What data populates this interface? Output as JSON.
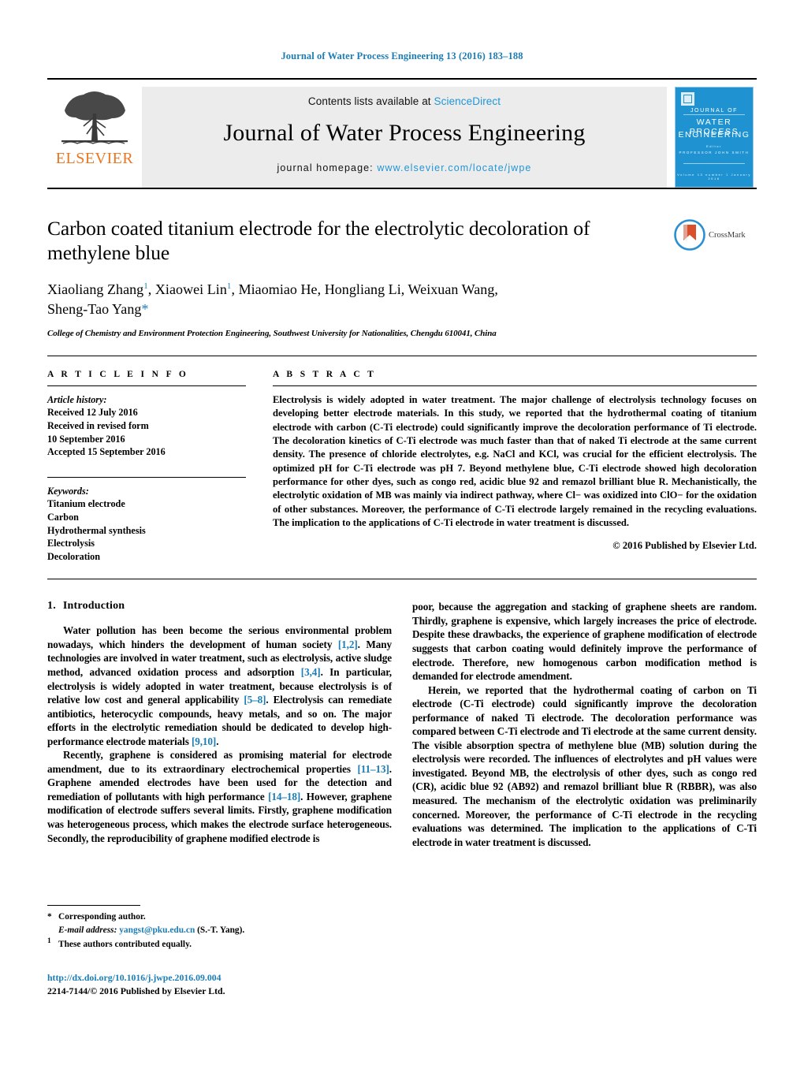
{
  "running_head": "Journal of Water Process Engineering 13 (2016) 183–188",
  "masthead": {
    "contents_prefix": "Contents lists available at ",
    "sciencedirect": "ScienceDirect",
    "journal_title": "Journal of Water Process Engineering",
    "homepage_prefix": "journal homepage: ",
    "homepage_url": "www.elsevier.com/locate/jwpe",
    "publisher_word": "ELSEVIER",
    "publisher_color": "#E87722",
    "link_color": "#2196d6",
    "cover": {
      "line1": "JOURNAL OF",
      "line2": "WATER PROCESS",
      "line3": "ENGINEERING",
      "line4": "Editor",
      "line5": "PROFESSOR JOHN SMITH",
      "line6": "Volume 13 number 1 January 2016",
      "background": "#1f93d2"
    }
  },
  "article": {
    "title": "Carbon coated titanium electrode for the electrolytic decoloration of methylene blue",
    "authors_line1_a": "Xiaoliang Zhang",
    "authors_sup1": "1",
    "authors_line1_b": ", Xiaowei Lin",
    "authors_sup2": "1",
    "authors_line1_c": ", Miaomiao He, Hongliang Li, Weixuan Wang,",
    "authors_line2": "Sheng-Tao Yang",
    "authors_star": "*",
    "affiliation": "College of Chemistry and Environment Protection Engineering, Southwest University for Nationalities, Chengdu 610041, China",
    "crossmark_label": "CrossMark"
  },
  "article_info": {
    "heading": "A R T I C L E   I N F O",
    "history_label": "Article history:",
    "history": [
      "Received 12 July 2016",
      "Received in revised form",
      "10 September 2016",
      "Accepted 15 September 2016"
    ],
    "keywords_label": "Keywords:",
    "keywords": [
      "Titanium electrode",
      "Carbon",
      "Hydrothermal synthesis",
      "Electrolysis",
      "Decoloration"
    ]
  },
  "abstract": {
    "heading": "A B S T R A C T",
    "text": "Electrolysis is widely adopted in water treatment. The major challenge of electrolysis technology focuses on developing better electrode materials. In this study, we reported that the hydrothermal coating of titanium electrode with carbon (C-Ti electrode) could significantly improve the decoloration performance of Ti electrode. The decoloration kinetics of C-Ti electrode was much faster than that of naked Ti electrode at the same current density. The presence of chloride electrolytes, e.g. NaCl and KCl, was crucial for the efficient electrolysis. The optimized pH for C-Ti electrode was pH 7. Beyond methylene blue, C-Ti electrode showed high decoloration performance for other dyes, such as congo red, acidic blue 92 and remazol brilliant blue R. Mechanistically, the electrolytic oxidation of MB was mainly via indirect pathway, where Cl− was oxidized into ClO− for the oxidation of other substances. Moreover, the performance of C-Ti electrode largely remained in the recycling evaluations. The implication to the applications of C-Ti electrode in water treatment is discussed.",
    "copyright": "© 2016 Published by Elsevier Ltd."
  },
  "body": {
    "section_number": "1.",
    "section_title": "Introduction",
    "left_paragraphs": [
      {
        "segments": [
          {
            "t": "Water pollution has been become the serious environmental problem nowadays, which hinders the development of human society "
          },
          {
            "t": "[1,2]",
            "ref": true
          },
          {
            "t": ". Many technologies are involved in water treatment, such as electrolysis, active sludge method, advanced oxidation process and adsorption "
          },
          {
            "t": "[3,4]",
            "ref": true
          },
          {
            "t": ". In particular, electrolysis is widely adopted in water treatment, because electrolysis is of relative low cost and general applicability "
          },
          {
            "t": "[5–8]",
            "ref": true
          },
          {
            "t": ". Electrolysis can remediate antibiotics, heterocyclic compounds, heavy metals, and so on. The major efforts in the electrolytic remediation should be dedicated to develop high-performance electrode materials "
          },
          {
            "t": "[9,10]",
            "ref": true
          },
          {
            "t": "."
          }
        ]
      },
      {
        "segments": [
          {
            "t": "Recently, graphene is considered as promising material for electrode amendment, due to its extraordinary electrochemical properties "
          },
          {
            "t": "[11–13]",
            "ref": true
          },
          {
            "t": ". Graphene amended electrodes have been used for the detection and remediation of pollutants with high performance "
          },
          {
            "t": "[14–18]",
            "ref": true
          },
          {
            "t": ". However, graphene modification of electrode suffers several limits. Firstly, graphene modification was heterogeneous process, which makes the electrode surface heterogeneous. Secondly, the reproducibility of graphene modified electrode is"
          }
        ]
      }
    ],
    "right_paragraphs": [
      {
        "indent": false,
        "segments": [
          {
            "t": "poor, because the aggregation and stacking of graphene sheets are random. Thirdly, graphene is expensive, which largely increases the price of electrode. Despite these drawbacks, the experience of graphene modification of electrode suggests that carbon coating would definitely improve the performance of electrode. Therefore, new homogenous carbon modification method is demanded for electrode amendment."
          }
        ]
      },
      {
        "indent": true,
        "segments": [
          {
            "t": "Herein, we reported that the hydrothermal coating of carbon on Ti electrode (C-Ti electrode) could significantly improve the decoloration performance of naked Ti electrode. The decoloration performance was compared between C-Ti electrode and Ti electrode at the same current density. The visible absorption spectra of methylene blue (MB) solution during the electrolysis were recorded. The influences of electrolytes and pH values were investigated. Beyond MB, the electrolysis of other dyes, such as congo red (CR), acidic blue 92 (AB92) and remazol brilliant blue R (RBBR), was also measured. The mechanism of the electrolytic oxidation was preliminarily concerned. Moreover, the performance of C-Ti electrode in the recycling evaluations was determined. The implication to the applications of C-Ti electrode in water treatment is discussed."
          }
        ]
      }
    ]
  },
  "footnotes": {
    "corresponding_mark": "*",
    "corresponding_text": "Corresponding author.",
    "email_label": "E-mail address:",
    "email": "yangst@pku.edu.cn",
    "email_suffix": "(S.-T. Yang).",
    "equal_mark": "1",
    "equal_text": "These authors contributed equally.",
    "doi": "http://dx.doi.org/10.1016/j.jwpe.2016.09.004",
    "issn_line": "2214-7144/© 2016 Published by Elsevier Ltd."
  }
}
